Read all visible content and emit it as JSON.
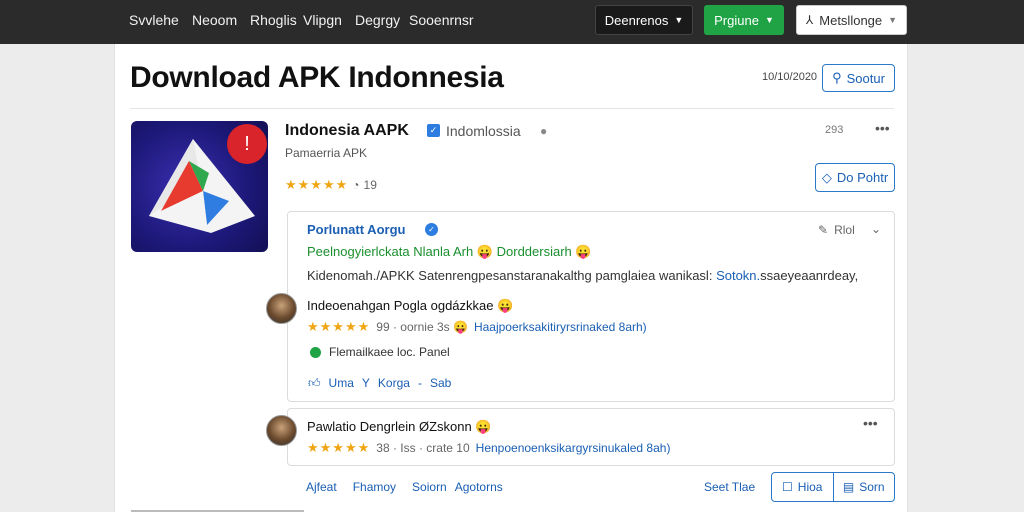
{
  "nav": {
    "links": [
      "Svvlehe",
      "Neoom",
      "Rhoglis",
      "Vlipgn",
      "Degrgy",
      "Sooenrnsr"
    ],
    "dropdown_label": "Deenrenos",
    "primary_label": "Prgiune",
    "account_label": "Metsllonge"
  },
  "page": {
    "title": "Download APK Indonnesia",
    "date": "10/10/2020",
    "search_label": "Sootur"
  },
  "app": {
    "name": "Indonesia AAPK",
    "developer": "Indomlossia",
    "subtitle": "Pamaerria APK",
    "stars": "★★★★★",
    "rating_count": "19",
    "top_count": "293",
    "follow_label": "Do Pohtr",
    "badge_symbol": "!"
  },
  "reviews_box": {
    "title": "Porlunatt Aorgu",
    "sort_label": "Rlol",
    "highlight": "Peelnogyierlckata Nlanla Arh 😛 Dorddersiarh 😛",
    "desc_text": "Kidenomah./APKK Satenrengpesanstaranakalthg pamglaiea wanikasl:",
    "desc_link": "Sotokn.",
    "desc_tail": "ssaeyeaanrdeay,"
  },
  "review1": {
    "name": "Indeoenahgan Pogla ogdázkkae 😛",
    "stars": "★★★★★",
    "meta": "99 ·  oornie 3s 😛",
    "link": "Haajpoerksakitiryrsrinaked 8arh)",
    "body": "Flemailkaee loc. Panel",
    "actions": [
      "Uma",
      "Y",
      "Korga",
      "-",
      "Sab"
    ]
  },
  "review2": {
    "name": "Pawlatio Dengrlein ØZskonn 😛",
    "stars": "★★★★★",
    "meta": "38 · Iss · crate 10",
    "link": "Henpoenoenksikargyrsinukaled 8ah)"
  },
  "footer": {
    "links": [
      "Ajfeat",
      "Fhamoy",
      "Soiorn",
      "Agotorns"
    ],
    "sort_label": "Seet Tlae",
    "view_list": "Hioa",
    "view_grid": "Sorn"
  }
}
